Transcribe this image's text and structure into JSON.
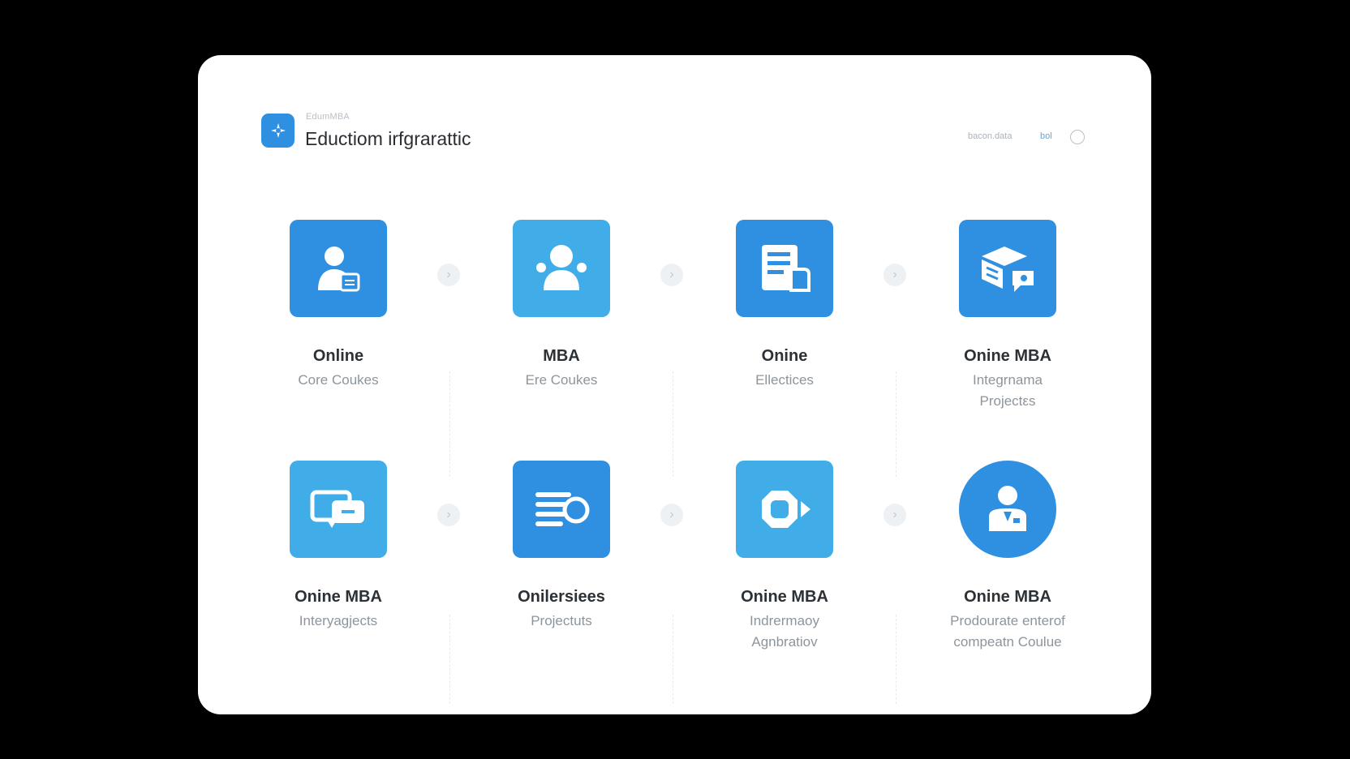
{
  "header": {
    "brand_small": "EdumMBA",
    "title": "Eductiom irfgrarattic",
    "link_1": "bacon.data",
    "link_2": "bol"
  },
  "steps": [
    {
      "title": "Online",
      "lines": [
        "Core Coukes"
      ],
      "icon": "student-icon"
    },
    {
      "title": "MBA",
      "lines": [
        "Ere Coukes"
      ],
      "icon": "group-user-icon"
    },
    {
      "title": "Onine",
      "lines": [
        "Ellectices"
      ],
      "icon": "document-icon"
    },
    {
      "title": "Onine MBA",
      "lines": [
        "Integrnama",
        "Projectεs"
      ],
      "icon": "package-icon"
    },
    {
      "title": "Onine MBA",
      "lines": [
        "Interyagjects"
      ],
      "icon": "chat-screen-icon"
    },
    {
      "title": "Onilersiees",
      "lines": [
        "Projectuts"
      ],
      "icon": "list-record-icon"
    },
    {
      "title": "Onine MBA",
      "lines": [
        "Indrermaoy",
        "Agnbratiov"
      ],
      "icon": "video-play-icon"
    },
    {
      "title": "Onine MBA",
      "lines": [
        "Prodourate enterof",
        "compeatn Coulue"
      ],
      "icon": "user-badge-icon"
    }
  ],
  "colors": {
    "accent_dark": "#2f8fe0",
    "accent_light": "#41ade8",
    "card_background": "#ffffff",
    "page_background": "#000000"
  }
}
